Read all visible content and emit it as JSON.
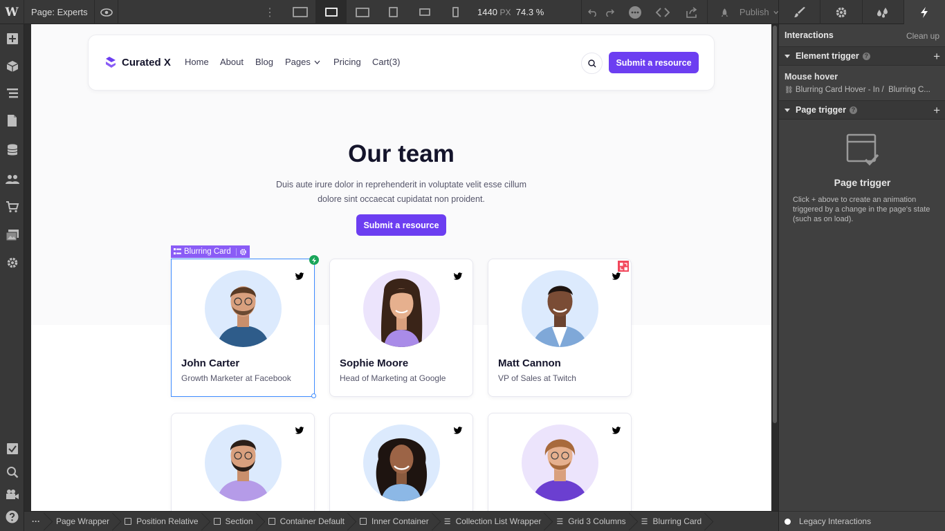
{
  "topbar": {
    "logo": "W",
    "page_label": "Page: Experts",
    "width_value": "1440",
    "width_unit": "PX",
    "zoom": "74.3 %",
    "publish_label": "Publish"
  },
  "site": {
    "brand": "Curated X",
    "nav": [
      "Home",
      "About",
      "Blog",
      "Pages",
      "Pricing",
      "Cart(3)"
    ],
    "nav_cta": "Submit a resource",
    "title": "Our team",
    "subtitle": "Duis aute irure dolor in reprehenderit in voluptate velit esse cillum dolore sint occaecat cupidatat non proident.",
    "cta": "Submit a resource",
    "selected_tag": "Blurring Card",
    "members": [
      {
        "name": "John Carter",
        "role": "Growth Marketer at Facebook"
      },
      {
        "name": "Sophie Moore",
        "role": "Head of Marketing at Google"
      },
      {
        "name": "Matt Cannon",
        "role": "VP of Sales at Twitch"
      },
      {
        "name": "",
        "role": ""
      },
      {
        "name": "",
        "role": ""
      },
      {
        "name": "",
        "role": ""
      }
    ]
  },
  "breadcrumbs": [
    "Page Wrapper",
    "Position Relative",
    "Section",
    "Container Default",
    "Inner Container",
    "Collection List Wrapper",
    "Grid 3 Columns",
    "Blurring Card"
  ],
  "panel": {
    "heading": "Interactions",
    "clean_up": "Clean up",
    "element_trigger": "Element trigger",
    "mouse_hover": "Mouse hover",
    "mouse_hover_detail": "Blurring Card Hover - In /  Blurring C...",
    "page_trigger": "Page trigger",
    "page_trigger_title": "Page trigger",
    "page_trigger_desc": "Click + above to create an animation triggered by a change in the page's state (such as on load).",
    "legacy": "Legacy Interactions"
  },
  "colors": {
    "accent": "#6c3ef1",
    "selection": "#3f8cff",
    "tag": "#8a5cf6"
  }
}
